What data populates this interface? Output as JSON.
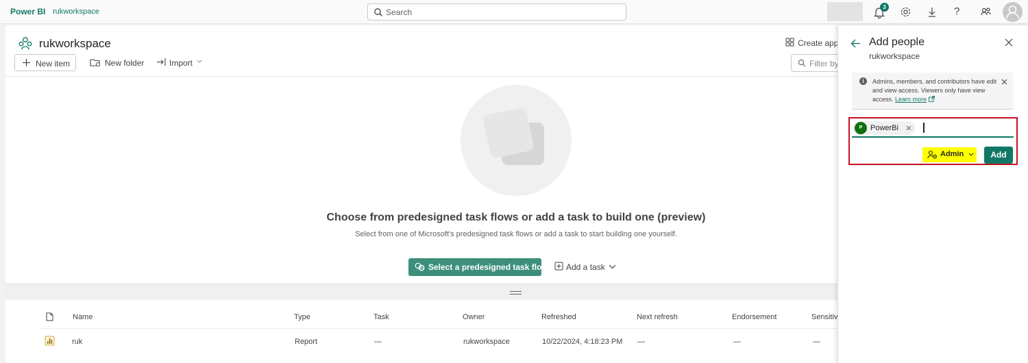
{
  "topbar": {
    "brand": "Power BI",
    "workspace_crumb": "rukworkspace",
    "search_placeholder": "Search",
    "notification_count": "3"
  },
  "workspace": {
    "title": "rukworkspace",
    "create_app_label": "Create app",
    "filter_placeholder": "Filter by"
  },
  "toolbar": {
    "new_item_label": "New item",
    "new_folder_label": "New folder",
    "import_label": "Import"
  },
  "hero": {
    "title": "Choose from predesigned task flows or add a task to build one (preview)",
    "subtitle": "Select from one of Microsoft's predesigned task flows or add a task to start building one yourself.",
    "primary_button": "Select a predesigned task flow",
    "secondary_button": "Add a task"
  },
  "table": {
    "columns": [
      "Name",
      "Type",
      "Task",
      "Owner",
      "Refreshed",
      "Next refresh",
      "Endorsement",
      "Sensitiv"
    ],
    "rows": [
      {
        "name": "ruk",
        "type": "Report",
        "task": "—",
        "owner": "rukworkspace",
        "refreshed": "10/22/2024, 4:18:23 PM",
        "next_refresh": "—",
        "endorsement": "—",
        "sensitivity": "—"
      }
    ]
  },
  "panel": {
    "title": "Add people",
    "subtitle": "rukworkspace",
    "info_text": "Admins, members, and contributors have edit and view access. Viewers only have view access.",
    "learn_more": "Learn more",
    "chip_initial": "P",
    "chip_name": "PowerBi",
    "role_label": "Admin",
    "add_label": "Add"
  },
  "colors": {
    "accent": "#117865",
    "highlight": "#ffff00",
    "red_outline": "#c50f1f"
  }
}
